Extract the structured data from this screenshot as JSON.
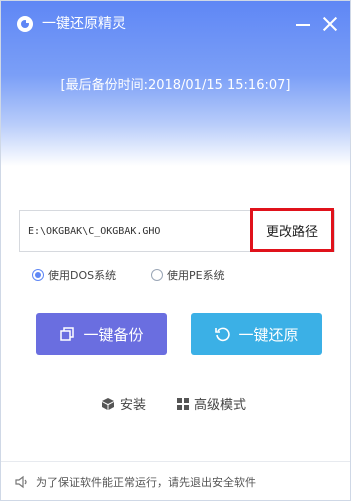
{
  "app": {
    "title": "一键还原精灵"
  },
  "header": {
    "backup_time": "[最后备份时间:2018/01/15 15:16:07]"
  },
  "path": {
    "value": "E:\\OKGBAK\\C_OKGBAK.GHO",
    "change_label": "更改路径"
  },
  "mode_options": [
    {
      "label": "使用DOS系统",
      "selected": true
    },
    {
      "label": "使用PE系统",
      "selected": false
    }
  ],
  "actions": {
    "backup_label": "一键备份",
    "restore_label": "一键还原"
  },
  "links": {
    "install_label": "安装",
    "advanced_label": "高级模式"
  },
  "footer": {
    "notice": "为了保证软件能正常运行，请先退出安全软件"
  },
  "colors": {
    "header_blue": "#5f87f5",
    "backup_purple": "#6a6ee0",
    "restore_blue": "#3bb0e6",
    "highlight_red": "#e0121b"
  }
}
